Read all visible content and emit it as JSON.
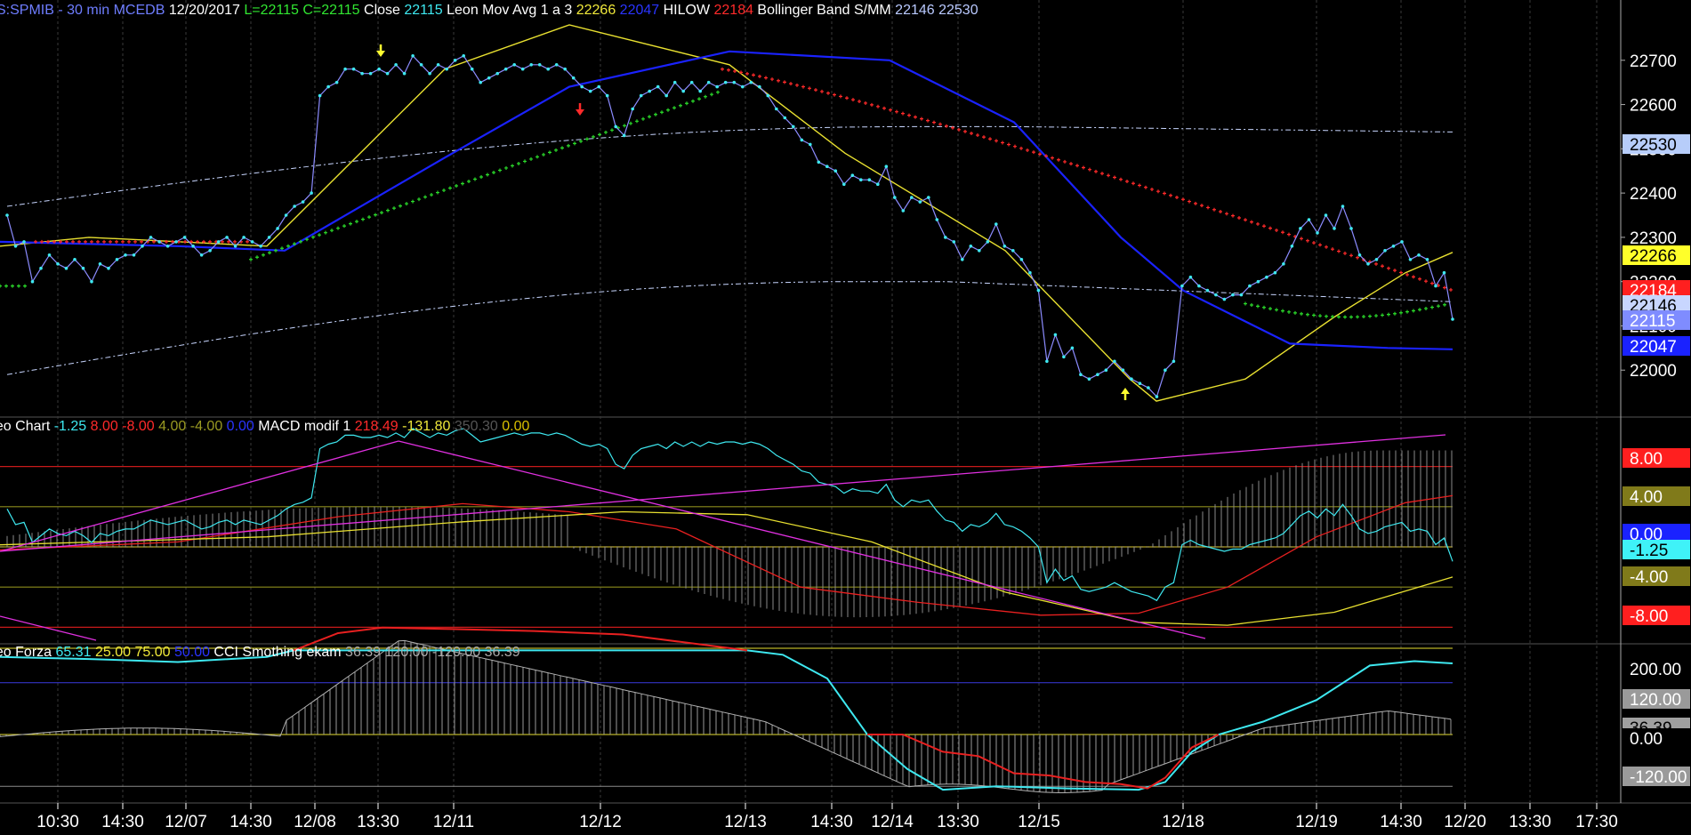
{
  "panels": {
    "price": {
      "legend": [
        {
          "text": "S:SPMIB - 30 min",
          "color": "#6e7dff"
        },
        {
          "text": "MCEDB",
          "color": "#6e7dff"
        },
        {
          "text": "12/20/2017",
          "color": "#ffffff"
        },
        {
          "text": "L=22115",
          "color": "#31e631"
        },
        {
          "text": "C=22115",
          "color": "#31e631"
        },
        {
          "text": "Close",
          "color": "#ffffff"
        },
        {
          "text": "22115",
          "color": "#3ee8f0"
        },
        {
          "text": "Leon Mov Avg 1 a 3",
          "color": "#ffffff"
        },
        {
          "text": "22266",
          "color": "#f0e83a"
        },
        {
          "text": "22047",
          "color": "#2a34ff"
        },
        {
          "text": "HILOW",
          "color": "#ffffff"
        },
        {
          "text": "22184",
          "color": "#ff2a2a"
        },
        {
          "text": "Bollinger Band S/MM",
          "color": "#ffffff"
        },
        {
          "text": "22146",
          "color": "#b9c9ff"
        },
        {
          "text": "22530",
          "color": "#b9c9ff"
        }
      ],
      "axis_ticks": [
        "22700",
        "22600",
        "22500",
        "22400",
        "22300",
        "22200",
        "22100",
        "22000"
      ],
      "value_tags": [
        {
          "text": "22530",
          "bg": "#b7cdfa",
          "fg": "#000000",
          "value": 22530
        },
        {
          "text": "22266",
          "bg": "#ffff2a",
          "fg": "#000000",
          "value": 22266
        },
        {
          "text": "22184",
          "bg": "#ff1f1f",
          "fg": "#ffffff",
          "value": 22184
        },
        {
          "text": "22146",
          "bg": "#c8d6ff",
          "fg": "#000000",
          "value": 22146
        },
        {
          "text": "22115",
          "bg": "#7f8cff",
          "fg": "#ffffff",
          "value": 22115
        },
        {
          "text": "22047",
          "bg": "#1a22ff",
          "fg": "#ffffff",
          "value": 22047
        }
      ]
    },
    "macd": {
      "legend": [
        {
          "text": "Leo Chart",
          "color": "#ffffff"
        },
        {
          "text": "-1.25",
          "color": "#3ee8f0"
        },
        {
          "text": "8.00",
          "color": "#ff2a2a"
        },
        {
          "text": "-8.00",
          "color": "#ff2a2a"
        },
        {
          "text": "4.00",
          "color": "#9a9a22"
        },
        {
          "text": "-4.00",
          "color": "#9a9a22"
        },
        {
          "text": "0.00",
          "color": "#2a34ff"
        },
        {
          "text": "MACD modif 1",
          "color": "#ffffff"
        },
        {
          "text": "218.49",
          "color": "#ff2a2a"
        },
        {
          "text": "-131.80",
          "color": "#f0e83a"
        },
        {
          "text": "350.30",
          "color": "#555555"
        },
        {
          "text": "0.00",
          "color": "#d8c000"
        }
      ],
      "value_tags": [
        {
          "text": "8.00",
          "bg": "#ff1f1f",
          "fg": "#ffffff",
          "value": 8
        },
        {
          "text": "4.00",
          "bg": "#807a1a",
          "fg": "#ffffff",
          "value": 4
        },
        {
          "text": "0.00",
          "bg": "#1a22ff",
          "fg": "#ffffff",
          "value": 0
        },
        {
          "text": "-1.25",
          "bg": "#3ff2f8",
          "fg": "#000000",
          "value": -1.25
        },
        {
          "text": "-4.00",
          "bg": "#807a1a",
          "fg": "#ffffff",
          "value": -4
        },
        {
          "text": "-8.00",
          "bg": "#ff1f1f",
          "fg": "#ffffff",
          "value": -8
        }
      ]
    },
    "cci": {
      "legend": [
        {
          "text": "Leo Forza",
          "color": "#ffffff"
        },
        {
          "text": "65.31",
          "color": "#3ee8f0"
        },
        {
          "text": "25.00",
          "color": "#f0e83a"
        },
        {
          "text": "75.00",
          "color": "#f0e83a"
        },
        {
          "text": "50.00",
          "color": "#2a34ff"
        },
        {
          "text": "CCI Smothing ekam",
          "color": "#ffffff"
        },
        {
          "text": "36.39",
          "color": "#aaaaaa"
        },
        {
          "text": "120.00",
          "color": "#aaaaaa"
        },
        {
          "text": "-120.00",
          "color": "#aaaaaa"
        },
        {
          "text": "36.39",
          "color": "#aaaaaa"
        }
      ],
      "value_tags": [
        {
          "text": "200.00",
          "bg": "#000000",
          "fg": "#ffffff",
          "value": 200
        },
        {
          "text": "120.00",
          "bg": "#9a9a9a",
          "fg": "#ffffff",
          "value": 120
        },
        {
          "text": "36.39",
          "bg": "#a0a0a0",
          "fg": "#000000",
          "value": 36.39
        },
        {
          "text": "0.00",
          "bg": "#000000",
          "fg": "#ffffff",
          "value": 0
        },
        {
          "text": "-120.00",
          "bg": "#9a9a9a",
          "fg": "#ffffff",
          "value": -120
        }
      ]
    }
  },
  "time_axis": [
    {
      "label": "10:30",
      "major": false
    },
    {
      "label": "14:30",
      "major": false
    },
    {
      "label": "12/07",
      "major": true
    },
    {
      "label": "14:30",
      "major": false
    },
    {
      "label": "12/08",
      "major": true
    },
    {
      "label": "13:30",
      "major": false
    },
    {
      "label": "12/11",
      "major": true
    },
    {
      "label": "12/12",
      "major": true
    },
    {
      "label": "12/13",
      "major": true
    },
    {
      "label": "14:30",
      "major": false
    },
    {
      "label": "12/14",
      "major": true
    },
    {
      "label": "13:30",
      "major": false
    },
    {
      "label": "12/15",
      "major": true
    },
    {
      "label": "12/18",
      "major": true
    },
    {
      "label": "12/19",
      "major": true
    },
    {
      "label": "14:30",
      "major": false
    },
    {
      "label": "12/20",
      "major": true
    },
    {
      "label": "13:30",
      "major": false
    },
    {
      "label": "17:30",
      "major": false
    }
  ],
  "chart_data": {
    "type": "line",
    "symbol": "S:SPMIB",
    "interval": "30 min",
    "y_range": [
      21900,
      22800
    ],
    "close": [
      22350,
      22280,
      22290,
      22200,
      22230,
      22260,
      22240,
      22230,
      22250,
      22230,
      22200,
      22240,
      22230,
      22250,
      22260,
      22260,
      22280,
      22300,
      22290,
      22280,
      22290,
      22300,
      22280,
      22260,
      22270,
      22290,
      22300,
      22280,
      22300,
      22290,
      22280,
      22300,
      22320,
      22350,
      22370,
      22380,
      22400,
      22620,
      22640,
      22650,
      22680,
      22680,
      22670,
      22670,
      22680,
      22670,
      22690,
      22670,
      22710,
      22690,
      22670,
      22690,
      22680,
      22700,
      22710,
      22680,
      22650,
      22660,
      22670,
      22680,
      22690,
      22680,
      22690,
      22690,
      22680,
      22690,
      22680,
      22660,
      22640,
      22630,
      22640,
      22620,
      22550,
      22530,
      22590,
      22620,
      22630,
      22640,
      22620,
      22650,
      22630,
      22650,
      22630,
      22650,
      22640,
      22650,
      22650,
      22640,
      22650,
      22640,
      22620,
      22590,
      22570,
      22550,
      22520,
      22510,
      22470,
      22460,
      22450,
      22420,
      22440,
      22430,
      22430,
      22420,
      22460,
      22390,
      22360,
      22390,
      22380,
      22390,
      22340,
      22300,
      22290,
      22250,
      22280,
      22270,
      22290,
      22330,
      22280,
      22270,
      22250,
      22220,
      22180,
      22020,
      22080,
      22030,
      22050,
      21990,
      21980,
      21990,
      22000,
      22020,
      22000,
      21980,
      21970,
      21960,
      21940,
      22000,
      22020,
      22190,
      22210,
      22190,
      22180,
      22170,
      22160,
      22170,
      22170,
      22190,
      22200,
      22210,
      22220,
      22240,
      22280,
      22320,
      22340,
      22310,
      22350,
      22320,
      22370,
      22320,
      22260,
      22240,
      22250,
      22270,
      22280,
      22290,
      22250,
      22260,
      22250,
      22190,
      22220,
      22115
    ],
    "series": [
      {
        "name": "Close",
        "last": 22115
      },
      {
        "name": "Leon Mov Avg 1 a 3",
        "values_last": [
          22266,
          22047
        ]
      },
      {
        "name": "HILOW",
        "last": 22184
      },
      {
        "name": "Bollinger Band S/MM",
        "values_last": [
          22146,
          22530
        ]
      }
    ],
    "macd": {
      "name": "MACD modif 1",
      "values_last": [
        218.49,
        -131.8,
        350.3,
        0.0
      ],
      "levels": [
        8,
        4,
        0,
        -4,
        -8
      ],
      "leo_chart_last": -1.25
    },
    "cci": {
      "name": "CCI Smothing ekam",
      "last": 36.39,
      "levels": [
        200,
        120,
        0,
        -120
      ],
      "leo_forza_last": 65.31
    }
  }
}
